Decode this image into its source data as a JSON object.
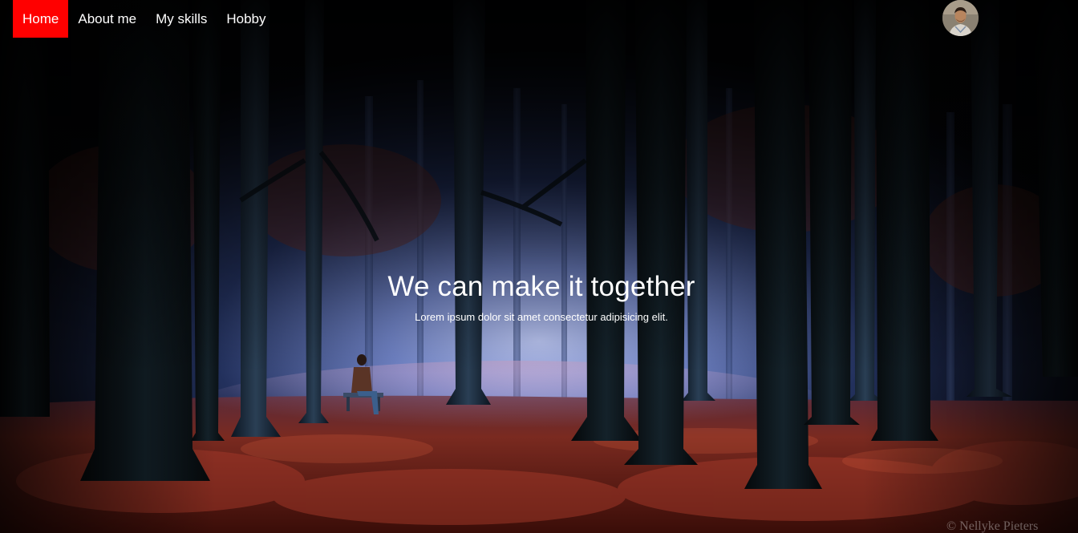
{
  "nav": {
    "items": [
      {
        "label": "Home",
        "active": true
      },
      {
        "label": "About me",
        "active": false
      },
      {
        "label": "My skills",
        "active": false
      },
      {
        "label": "Hobby",
        "active": false
      }
    ],
    "active_color": "#ff0000"
  },
  "avatar": {
    "icon": "profile-photo"
  },
  "hero": {
    "title": "We can make it together",
    "subtitle": "Lorem ipsum dolor sit amet consectetur adipisicing elit."
  },
  "background": {
    "watermark": "© Nellyke Pieters"
  }
}
